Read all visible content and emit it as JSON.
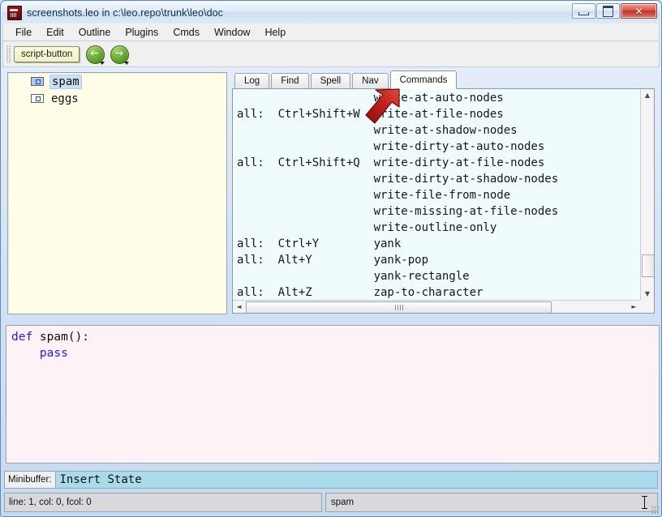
{
  "window": {
    "title": "screenshots.leo in c:\\leo.repo\\trunk\\leo\\doc",
    "icon": "leo-app-icon",
    "minimize_label": "",
    "maximize_label": "",
    "close_label": "✕"
  },
  "menubar": {
    "items": [
      {
        "label": "File"
      },
      {
        "label": "Edit"
      },
      {
        "label": "Outline"
      },
      {
        "label": "Plugins"
      },
      {
        "label": "Cmds"
      },
      {
        "label": "Window"
      },
      {
        "label": "Help"
      }
    ]
  },
  "toolbar": {
    "script_button_label": "script-button",
    "back_icon": "←",
    "forward_icon": "→",
    "back_name": "back-button",
    "forward_name": "forward-button"
  },
  "tree": {
    "nodes": [
      {
        "label": "spam",
        "selected": true
      },
      {
        "label": "eggs",
        "selected": false
      }
    ]
  },
  "log_pane": {
    "tabs": [
      {
        "label": "Log",
        "active": false
      },
      {
        "label": "Find",
        "active": false
      },
      {
        "label": "Spell",
        "active": false
      },
      {
        "label": "Nav",
        "active": false
      },
      {
        "label": "Commands",
        "active": true
      }
    ],
    "commands": [
      {
        "scope": "",
        "binding": "",
        "name": "write-at-auto-nodes"
      },
      {
        "scope": "all:",
        "binding": "Ctrl+Shift+W",
        "name": "write-at-file-nodes"
      },
      {
        "scope": "",
        "binding": "",
        "name": "write-at-shadow-nodes"
      },
      {
        "scope": "",
        "binding": "",
        "name": "write-dirty-at-auto-nodes"
      },
      {
        "scope": "all:",
        "binding": "Ctrl+Shift+Q",
        "name": "write-dirty-at-file-nodes"
      },
      {
        "scope": "",
        "binding": "",
        "name": "write-dirty-at-shadow-nodes"
      },
      {
        "scope": "",
        "binding": "",
        "name": "write-file-from-node"
      },
      {
        "scope": "",
        "binding": "",
        "name": "write-missing-at-file-nodes"
      },
      {
        "scope": "",
        "binding": "",
        "name": "write-outline-only"
      },
      {
        "scope": "all:",
        "binding": "Ctrl+Y",
        "name": "yank"
      },
      {
        "scope": "all:",
        "binding": "Alt+Y",
        "name": "yank-pop"
      },
      {
        "scope": "",
        "binding": "",
        "name": "yank-rectangle"
      },
      {
        "scope": "all:",
        "binding": "Alt+Z",
        "name": "zap-to-character"
      }
    ],
    "scrollbar": {
      "v_up": "▲",
      "v_down": "▼",
      "h_left": "◄",
      "h_right": "►"
    }
  },
  "annotation": {
    "arrow_color": "#b01d1d",
    "arrow_name": "red-callout-arrow-to-commands-tab"
  },
  "body": {
    "lines": [
      {
        "indent": "",
        "keyword": "def",
        "rest": " spam():"
      },
      {
        "indent": "    ",
        "keyword": "pass",
        "rest": ""
      }
    ]
  },
  "minibuffer": {
    "label": "Minibuffer:",
    "value": "Insert State"
  },
  "statusbar": {
    "left": "line: 1, col: 0, fcol: 0",
    "right": "spam"
  },
  "colors": {
    "tree_bg": "#fffde8",
    "log_bg": "#f0fbfd",
    "body_bg": "#fdf2f6",
    "minibuffer_bg": "#a9dceb",
    "accent_green": "#6bb032",
    "close_red": "#b8332a"
  }
}
